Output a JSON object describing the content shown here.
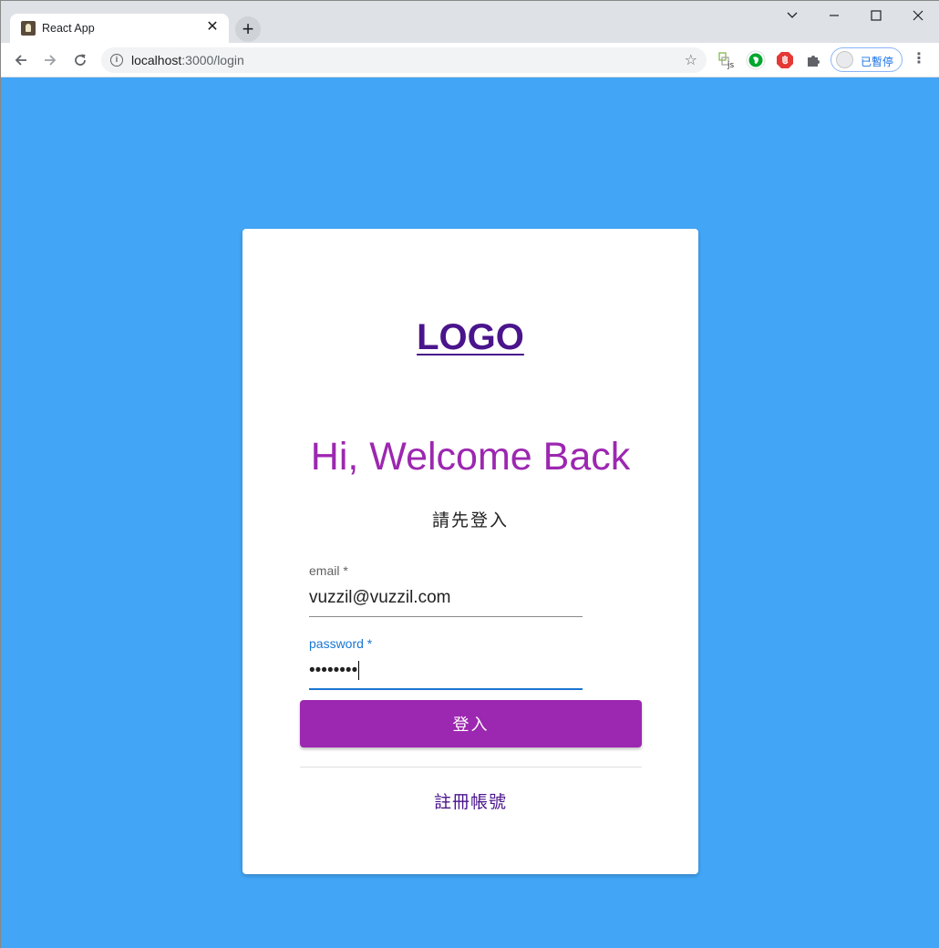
{
  "browser": {
    "tab_title": "React App",
    "url_host": "localhost",
    "url_rest": ":3000/login",
    "profile_label": "已暫停",
    "close_glyph": "✕",
    "newtab_glyph": "+",
    "menu_glyph": "⋮",
    "info_glyph": "i",
    "star_glyph": "☆"
  },
  "login": {
    "logo": "LOGO",
    "heading": "Hi, Welcome Back",
    "subtitle": "請先登入",
    "email_label": "email *",
    "email_value": "vuzzil@vuzzil.com",
    "password_label": "password *",
    "password_value": "••••••••",
    "submit_label": "登入",
    "register_label": "註冊帳號"
  },
  "colors": {
    "page_background": "#42a5f5",
    "primary_purple": "#9c27b0",
    "logo_purple": "#4a148c",
    "focus_blue": "#1976d2"
  }
}
